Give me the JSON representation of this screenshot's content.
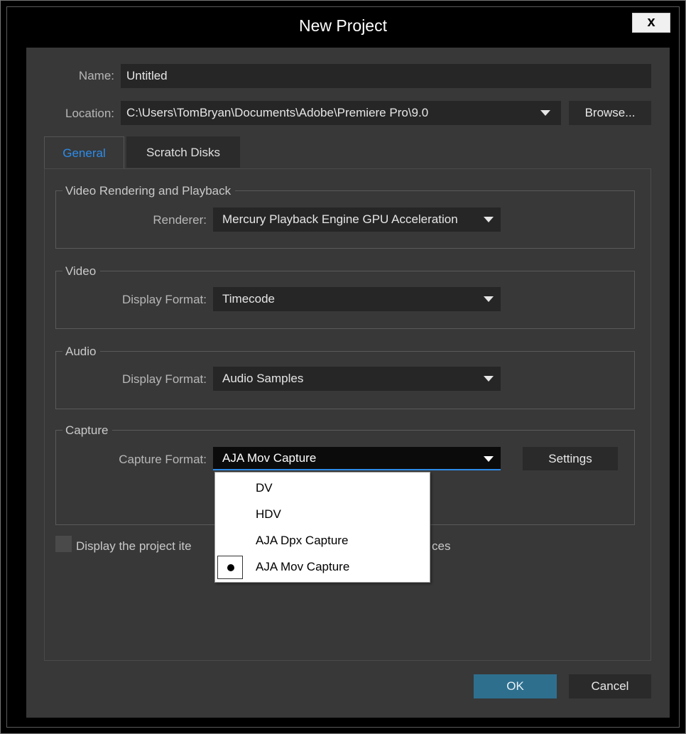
{
  "window": {
    "title": "New Project",
    "close_label": "x"
  },
  "project": {
    "name_label": "Name:",
    "name_value": "Untitled",
    "location_label": "Location:",
    "location_value": "C:\\Users\\TomBryan\\Documents\\Adobe\\Premiere Pro\\9.0",
    "browse_label": "Browse..."
  },
  "tabs": [
    {
      "label": "General",
      "active": true
    },
    {
      "label": "Scratch Disks",
      "active": false
    }
  ],
  "groups": {
    "video_rendering": {
      "title": "Video Rendering and Playback",
      "renderer_label": "Renderer:",
      "renderer_value": "Mercury Playback Engine GPU Acceleration"
    },
    "video": {
      "title": "Video",
      "display_format_label": "Display Format:",
      "display_format_value": "Timecode"
    },
    "audio": {
      "title": "Audio",
      "display_format_label": "Display Format:",
      "display_format_value": "Audio Samples"
    },
    "capture": {
      "title": "Capture",
      "capture_format_label": "Capture Format:",
      "capture_format_value": "AJA Mov Capture",
      "settings_label": "Settings"
    }
  },
  "capture_format_menu": {
    "items": [
      {
        "label": "DV",
        "selected": false
      },
      {
        "label": "HDV",
        "selected": false
      },
      {
        "label": "AJA Dpx Capture",
        "selected": false
      },
      {
        "label": "AJA Mov Capture",
        "selected": true
      }
    ]
  },
  "checkbox": {
    "label_visible_start": "Display the project ite",
    "label_visible_end": "ces",
    "checked": false
  },
  "footer": {
    "ok_label": "OK",
    "cancel_label": "Cancel"
  },
  "colors": {
    "dialog_bg": "#383838",
    "field_bg": "#262626",
    "accent_tab": "#2d8ceb",
    "ok_button": "#2e6f8e",
    "title_bar": "#000000"
  }
}
